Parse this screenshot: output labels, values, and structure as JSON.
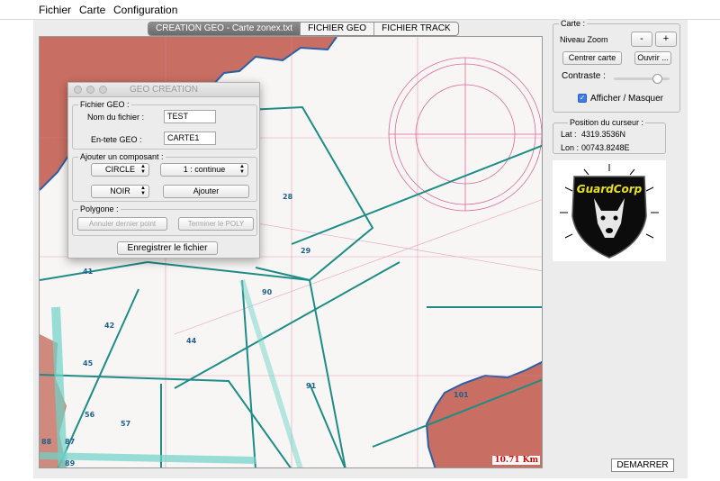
{
  "menubar": {
    "items": [
      "Fichier",
      "Carte",
      "Configuration"
    ]
  },
  "tabs": [
    {
      "label": "CREATION GEO - Carte  zonex.txt",
      "active": true
    },
    {
      "label": "FICHIER GEO",
      "active": false
    },
    {
      "label": "FICHIER TRACK",
      "active": false
    }
  ],
  "map": {
    "scale_label": "10.71 Km",
    "zone_numbers": [
      "28",
      "29",
      "41",
      "42",
      "44",
      "45",
      "56",
      "57",
      "87",
      "88",
      "89",
      "90",
      "91",
      "101"
    ],
    "colors": {
      "land": "#c96e62",
      "sea": "#f8f6f4",
      "zone_lines": "#1e8c86",
      "grid": "#e07aa6"
    }
  },
  "dialog": {
    "title": "GEO CREATION",
    "fichier_geo": {
      "title": "Fichier GEO :",
      "nom_label": "Nom du fichier :",
      "nom_value": "TEST",
      "entete_label": "En-tete GEO :",
      "entete_value": "CARTE1"
    },
    "composant": {
      "title": "Ajouter un composant :",
      "type_value": "CIRCLE",
      "style_value": "1 : continue",
      "color_value": "NOIR",
      "add_label": "Ajouter"
    },
    "polygone": {
      "title": "Polygone :",
      "cancel_point_label": "Annuler dernier point",
      "finish_label": "Terminer le POLY"
    },
    "save_label": "Enregistrer le fichier"
  },
  "right_panel": {
    "carte": {
      "title": "Carte :",
      "zoom_label": "Niveau Zoom",
      "zoom_minus": "-",
      "zoom_plus": "+",
      "center_label": "Centrer carte",
      "open_label": "Ouvrir ...",
      "contrast_label": "Contraste :",
      "contrast_level": 0.85,
      "toggle_label": "Afficher / Masquer",
      "toggle_checked": true
    },
    "cursor": {
      "title": "Position du curseur :",
      "lat_label": "Lat :",
      "lat_value": "4319.3536N",
      "lon_label": "Lon :",
      "lon_value": "00743.8248E"
    },
    "logo": {
      "text": "GuardCorp",
      "icon": "dog-shield-logo"
    }
  },
  "start_button": {
    "label": "DEMARRER"
  }
}
